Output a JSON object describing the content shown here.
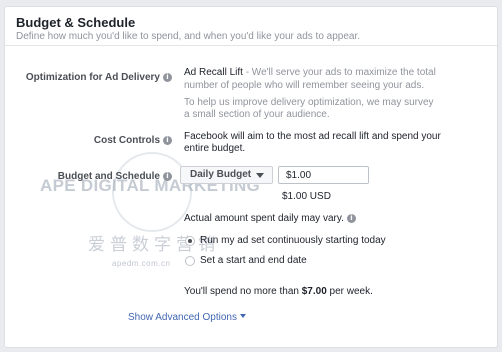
{
  "header": {
    "title": "Budget & Schedule",
    "subtitle": "Define how much you'd like to spend, and when you'd like your ads to appear."
  },
  "optimization": {
    "label": "Optimization for Ad Delivery",
    "value_strong": "Ad Recall Lift",
    "value_rest": " - We'll serve your ads to maximize the total",
    "value_line2": "number of people who will remember seeing your ads.",
    "note_line1": "To help us improve delivery optimization, we may survey",
    "note_line2": "a small section of your audience."
  },
  "cost_controls": {
    "label": "Cost Controls",
    "line1": "Facebook will aim to the most ad recall lift and spend your",
    "line2": "entire budget."
  },
  "budget": {
    "label": "Budget and Schedule",
    "dropdown_value": "Daily Budget",
    "amount_value": "$1.00",
    "amount_currency": "$1.00 USD",
    "note": "Actual amount spent daily may vary."
  },
  "schedule": {
    "option_continuous": "Run my ad set continuously starting today",
    "option_range": "Set a start and end date",
    "selected": "continuous"
  },
  "spend": {
    "prefix": "You'll spend no more than ",
    "amount": "$7.00",
    "suffix": " per week."
  },
  "advanced_link": "Show Advanced Options",
  "watermark": {
    "brand": "APE DIGITAL MARKETING",
    "chinese": "爱普数字营销",
    "domain": "apedm.com.cn"
  },
  "colors": {
    "link": "#4267b2",
    "label": "#4b4f56",
    "muted": "#90949c"
  }
}
